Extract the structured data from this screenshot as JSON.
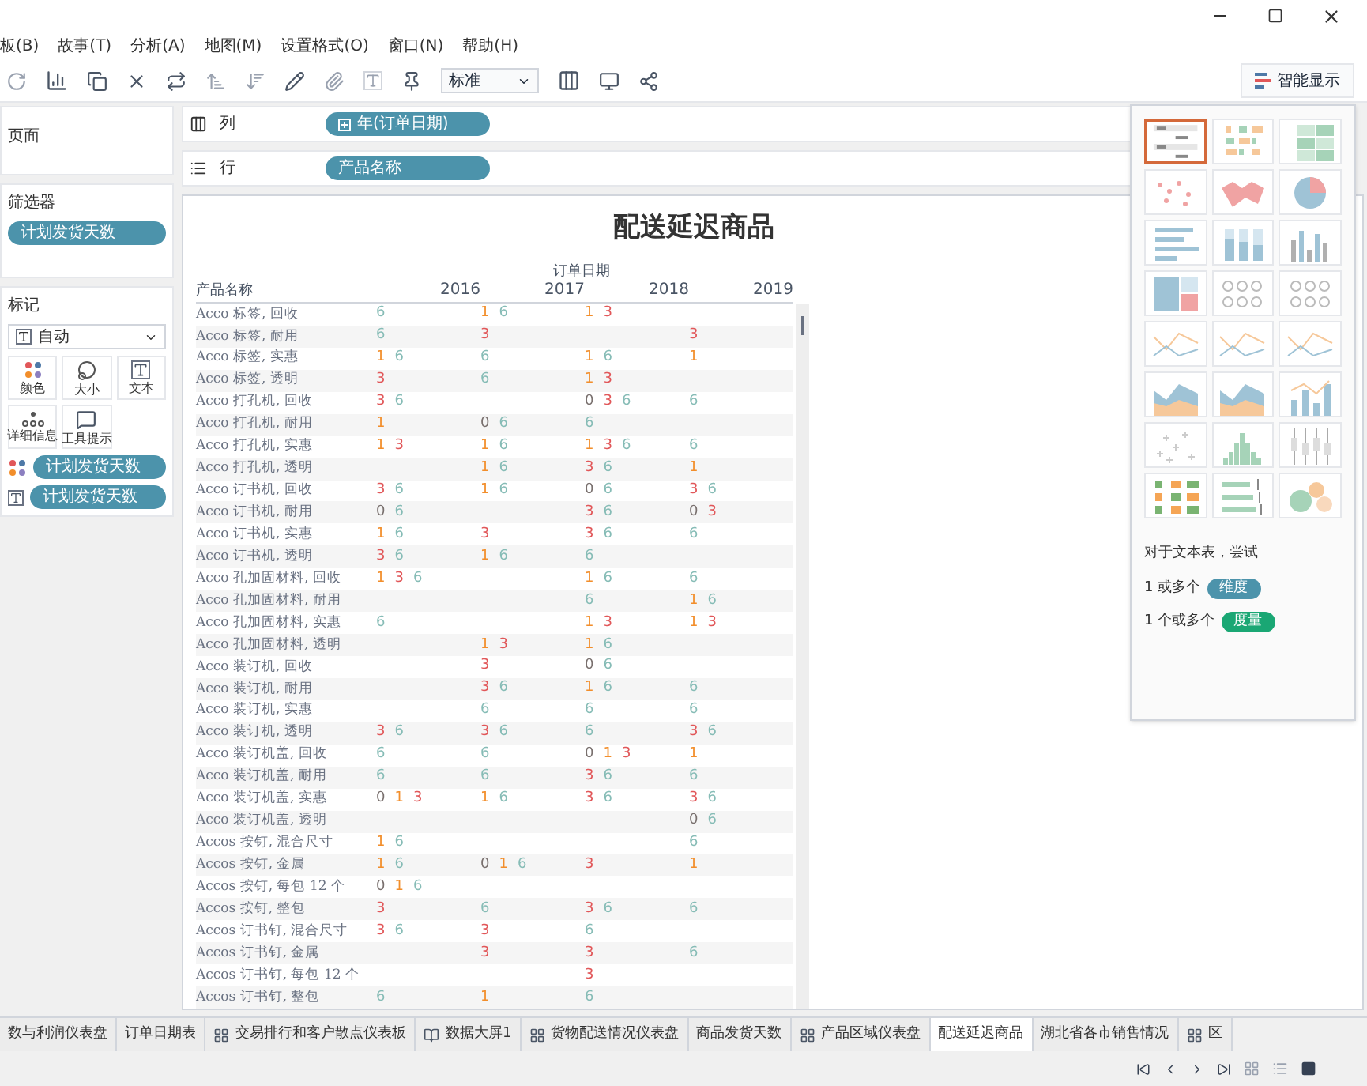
{
  "menu": [
    "板(B)",
    "故事(T)",
    "分析(A)",
    "地图(M)",
    "设置格式(O)",
    "窗口(N)",
    "帮助(H)"
  ],
  "toolbar": {
    "fit_select": "标准",
    "show_me_button": "智能显示"
  },
  "pages_card": {
    "title": "页面"
  },
  "filters_card": {
    "title": "筛选器",
    "pills": [
      "计划发货天数"
    ]
  },
  "marks_card": {
    "title": "标记",
    "mark_type": "自动",
    "buttons": [
      {
        "kind": "color",
        "label": "颜色"
      },
      {
        "kind": "size",
        "label": "大小"
      },
      {
        "kind": "text",
        "label": "文本"
      },
      {
        "kind": "detail",
        "label": "详细信息"
      },
      {
        "kind": "tooltip",
        "label": "工具提示"
      }
    ],
    "pills": [
      {
        "kind": "color",
        "label": "计划发货天数"
      },
      {
        "kind": "text",
        "label": "计划发货天数"
      }
    ]
  },
  "shelves": [
    {
      "kind": "columns",
      "label": "列",
      "pill": "年(订单日期)",
      "expandable": true
    },
    {
      "kind": "rows",
      "label": "行",
      "pill": "产品名称",
      "expandable": false
    }
  ],
  "viz": {
    "title": "配送延迟商品",
    "column_group": "订单日期",
    "row_header": "产品名称",
    "years": [
      "2016",
      "2017",
      "2018",
      "2019"
    ],
    "rows": [
      {
        "name": "Acco 标签, 回收",
        "cells": [
          [
            {
              "t": "6",
              "color": "#86bcb6"
            }
          ],
          [
            {
              "t": "1",
              "color": "#f28e2b"
            },
            {
              "t": "6",
              "color": "#86bcb6"
            }
          ],
          [
            {
              "t": "1",
              "color": "#f28e2b"
            },
            {
              "t": "3",
              "color": "#e15759"
            }
          ],
          []
        ]
      },
      {
        "name": "Acco 标签, 耐用",
        "cells": [
          [
            {
              "t": "6",
              "color": "#86bcb6"
            }
          ],
          [
            {
              "t": "3",
              "color": "#e15759"
            }
          ],
          [],
          [
            {
              "t": "3",
              "color": "#e15759"
            }
          ]
        ]
      },
      {
        "name": "Acco 标签, 实惠",
        "cells": [
          [
            {
              "t": "1",
              "color": "#f28e2b"
            },
            {
              "t": "6",
              "color": "#86bcb6"
            }
          ],
          [
            {
              "t": "6",
              "color": "#86bcb6"
            }
          ],
          [
            {
              "t": "1",
              "color": "#f28e2b"
            },
            {
              "t": "6",
              "color": "#86bcb6"
            }
          ],
          [
            {
              "t": "1",
              "color": "#f28e2b"
            }
          ]
        ]
      },
      {
        "name": "Acco 标签, 透明",
        "cells": [
          [
            {
              "t": "3",
              "color": "#e15759"
            }
          ],
          [
            {
              "t": "6",
              "color": "#86bcb6"
            }
          ],
          [
            {
              "t": "1",
              "color": "#f28e2b"
            },
            {
              "t": "3",
              "color": "#e15759"
            }
          ],
          []
        ]
      },
      {
        "name": "Acco 打孔机, 回收",
        "cells": [
          [
            {
              "t": "3",
              "color": "#e15759"
            },
            {
              "t": "6",
              "color": "#86bcb6"
            }
          ],
          [],
          [
            {
              "t": "0",
              "color": "#79706e"
            },
            {
              "t": "3",
              "color": "#e15759"
            },
            {
              "t": "6",
              "color": "#86bcb6"
            }
          ],
          [
            {
              "t": "6",
              "color": "#86bcb6"
            }
          ]
        ]
      },
      {
        "name": "Acco 打孔机, 耐用",
        "cells": [
          [
            {
              "t": "1",
              "color": "#f28e2b"
            }
          ],
          [
            {
              "t": "0",
              "color": "#79706e"
            },
            {
              "t": "6",
              "color": "#86bcb6"
            }
          ],
          [
            {
              "t": "6",
              "color": "#86bcb6"
            }
          ],
          []
        ]
      },
      {
        "name": "Acco 打孔机, 实惠",
        "cells": [
          [
            {
              "t": "1",
              "color": "#f28e2b"
            },
            {
              "t": "3",
              "color": "#e15759"
            }
          ],
          [
            {
              "t": "1",
              "color": "#f28e2b"
            },
            {
              "t": "6",
              "color": "#86bcb6"
            }
          ],
          [
            {
              "t": "1",
              "color": "#f28e2b"
            },
            {
              "t": "3",
              "color": "#e15759"
            },
            {
              "t": "6",
              "color": "#86bcb6"
            }
          ],
          [
            {
              "t": "6",
              "color": "#86bcb6"
            }
          ]
        ]
      },
      {
        "name": "Acco 打孔机, 透明",
        "cells": [
          [],
          [
            {
              "t": "1",
              "color": "#f28e2b"
            },
            {
              "t": "6",
              "color": "#86bcb6"
            }
          ],
          [
            {
              "t": "3",
              "color": "#e15759"
            },
            {
              "t": "6",
              "color": "#86bcb6"
            }
          ],
          [
            {
              "t": "1",
              "color": "#f28e2b"
            }
          ]
        ]
      },
      {
        "name": "Acco 订书机, 回收",
        "cells": [
          [
            {
              "t": "3",
              "color": "#e15759"
            },
            {
              "t": "6",
              "color": "#86bcb6"
            }
          ],
          [
            {
              "t": "1",
              "color": "#f28e2b"
            },
            {
              "t": "6",
              "color": "#86bcb6"
            }
          ],
          [
            {
              "t": "0",
              "color": "#79706e"
            },
            {
              "t": "6",
              "color": "#86bcb6"
            }
          ],
          [
            {
              "t": "3",
              "color": "#e15759"
            },
            {
              "t": "6",
              "color": "#86bcb6"
            }
          ]
        ]
      },
      {
        "name": "Acco 订书机, 耐用",
        "cells": [
          [
            {
              "t": "0",
              "color": "#79706e"
            },
            {
              "t": "6",
              "color": "#86bcb6"
            }
          ],
          [],
          [
            {
              "t": "3",
              "color": "#e15759"
            },
            {
              "t": "6",
              "color": "#86bcb6"
            }
          ],
          [
            {
              "t": "0",
              "color": "#79706e"
            },
            {
              "t": "3",
              "color": "#e15759"
            }
          ]
        ]
      },
      {
        "name": "Acco 订书机, 实惠",
        "cells": [
          [
            {
              "t": "1",
              "color": "#f28e2b"
            },
            {
              "t": "6",
              "color": "#86bcb6"
            }
          ],
          [
            {
              "t": "3",
              "color": "#e15759"
            }
          ],
          [
            {
              "t": "3",
              "color": "#e15759"
            },
            {
              "t": "6",
              "color": "#86bcb6"
            }
          ],
          [
            {
              "t": "6",
              "color": "#86bcb6"
            }
          ]
        ]
      },
      {
        "name": "Acco 订书机, 透明",
        "cells": [
          [
            {
              "t": "3",
              "color": "#e15759"
            },
            {
              "t": "6",
              "color": "#86bcb6"
            }
          ],
          [
            {
              "t": "1",
              "color": "#f28e2b"
            },
            {
              "t": "6",
              "color": "#86bcb6"
            }
          ],
          [
            {
              "t": "6",
              "color": "#86bcb6"
            }
          ],
          []
        ]
      },
      {
        "name": "Acco 孔加固材料, 回收",
        "cells": [
          [
            {
              "t": "1",
              "color": "#f28e2b"
            },
            {
              "t": "3",
              "color": "#e15759"
            },
            {
              "t": "6",
              "color": "#86bcb6"
            }
          ],
          [],
          [
            {
              "t": "1",
              "color": "#f28e2b"
            },
            {
              "t": "6",
              "color": "#86bcb6"
            }
          ],
          [
            {
              "t": "6",
              "color": "#86bcb6"
            }
          ]
        ]
      },
      {
        "name": "Acco 孔加固材料, 耐用",
        "cells": [
          [],
          [],
          [
            {
              "t": "6",
              "color": "#86bcb6"
            }
          ],
          [
            {
              "t": "1",
              "color": "#f28e2b"
            },
            {
              "t": "6",
              "color": "#86bcb6"
            }
          ]
        ]
      },
      {
        "name": "Acco 孔加固材料, 实惠",
        "cells": [
          [
            {
              "t": "6",
              "color": "#86bcb6"
            }
          ],
          [],
          [
            {
              "t": "1",
              "color": "#f28e2b"
            },
            {
              "t": "3",
              "color": "#e15759"
            }
          ],
          [
            {
              "t": "1",
              "color": "#f28e2b"
            },
            {
              "t": "3",
              "color": "#e15759"
            }
          ]
        ]
      },
      {
        "name": "Acco 孔加固材料, 透明",
        "cells": [
          [],
          [
            {
              "t": "1",
              "color": "#f28e2b"
            },
            {
              "t": "3",
              "color": "#e15759"
            }
          ],
          [
            {
              "t": "1",
              "color": "#f28e2b"
            },
            {
              "t": "6",
              "color": "#86bcb6"
            }
          ],
          []
        ]
      },
      {
        "name": "Acco 装订机, 回收",
        "cells": [
          [],
          [
            {
              "t": "3",
              "color": "#e15759"
            }
          ],
          [
            {
              "t": "0",
              "color": "#79706e"
            },
            {
              "t": "6",
              "color": "#86bcb6"
            }
          ],
          []
        ]
      },
      {
        "name": "Acco 装订机, 耐用",
        "cells": [
          [],
          [
            {
              "t": "3",
              "color": "#e15759"
            },
            {
              "t": "6",
              "color": "#86bcb6"
            }
          ],
          [
            {
              "t": "1",
              "color": "#f28e2b"
            },
            {
              "t": "6",
              "color": "#86bcb6"
            }
          ],
          [
            {
              "t": "6",
              "color": "#86bcb6"
            }
          ]
        ]
      },
      {
        "name": "Acco 装订机, 实惠",
        "cells": [
          [],
          [
            {
              "t": "6",
              "color": "#86bcb6"
            }
          ],
          [
            {
              "t": "6",
              "color": "#86bcb6"
            }
          ],
          [
            {
              "t": "6",
              "color": "#86bcb6"
            }
          ]
        ]
      },
      {
        "name": "Acco 装订机, 透明",
        "cells": [
          [
            {
              "t": "3",
              "color": "#e15759"
            },
            {
              "t": "6",
              "color": "#86bcb6"
            }
          ],
          [
            {
              "t": "3",
              "color": "#e15759"
            },
            {
              "t": "6",
              "color": "#86bcb6"
            }
          ],
          [
            {
              "t": "6",
              "color": "#86bcb6"
            }
          ],
          [
            {
              "t": "3",
              "color": "#e15759"
            },
            {
              "t": "6",
              "color": "#86bcb6"
            }
          ]
        ]
      },
      {
        "name": "Acco 装订机盖, 回收",
        "cells": [
          [
            {
              "t": "6",
              "color": "#86bcb6"
            }
          ],
          [
            {
              "t": "6",
              "color": "#86bcb6"
            }
          ],
          [
            {
              "t": "0",
              "color": "#79706e"
            },
            {
              "t": "1",
              "color": "#f28e2b"
            },
            {
              "t": "3",
              "color": "#e15759"
            }
          ],
          [
            {
              "t": "1",
              "color": "#f28e2b"
            }
          ]
        ]
      },
      {
        "name": "Acco 装订机盖, 耐用",
        "cells": [
          [
            {
              "t": "6",
              "color": "#86bcb6"
            }
          ],
          [
            {
              "t": "6",
              "color": "#86bcb6"
            }
          ],
          [
            {
              "t": "3",
              "color": "#e15759"
            },
            {
              "t": "6",
              "color": "#86bcb6"
            }
          ],
          [
            {
              "t": "6",
              "color": "#86bcb6"
            }
          ]
        ]
      },
      {
        "name": "Acco 装订机盖, 实惠",
        "cells": [
          [
            {
              "t": "0",
              "color": "#79706e"
            },
            {
              "t": "1",
              "color": "#f28e2b"
            },
            {
              "t": "3",
              "color": "#e15759"
            }
          ],
          [
            {
              "t": "1",
              "color": "#f28e2b"
            },
            {
              "t": "6",
              "color": "#86bcb6"
            }
          ],
          [
            {
              "t": "3",
              "color": "#e15759"
            },
            {
              "t": "6",
              "color": "#86bcb6"
            }
          ],
          [
            {
              "t": "3",
              "color": "#e15759"
            },
            {
              "t": "6",
              "color": "#86bcb6"
            }
          ]
        ]
      },
      {
        "name": "Acco 装订机盖, 透明",
        "cells": [
          [],
          [],
          [],
          [
            {
              "t": "0",
              "color": "#79706e"
            },
            {
              "t": "6",
              "color": "#86bcb6"
            }
          ]
        ]
      },
      {
        "name": "Accos 按钉, 混合尺寸",
        "cells": [
          [
            {
              "t": "1",
              "color": "#f28e2b"
            },
            {
              "t": "6",
              "color": "#86bcb6"
            }
          ],
          [],
          [],
          [
            {
              "t": "6",
              "color": "#86bcb6"
            }
          ]
        ]
      },
      {
        "name": "Accos 按钉, 金属",
        "cells": [
          [
            {
              "t": "1",
              "color": "#f28e2b"
            },
            {
              "t": "6",
              "color": "#86bcb6"
            }
          ],
          [
            {
              "t": "0",
              "color": "#79706e"
            },
            {
              "t": "1",
              "color": "#f28e2b"
            },
            {
              "t": "6",
              "color": "#86bcb6"
            }
          ],
          [
            {
              "t": "3",
              "color": "#e15759"
            }
          ],
          [
            {
              "t": "1",
              "color": "#f28e2b"
            }
          ]
        ]
      },
      {
        "name": "Accos 按钉, 每包 12 个",
        "cells": [
          [
            {
              "t": "0",
              "color": "#79706e"
            },
            {
              "t": "1",
              "color": "#f28e2b"
            },
            {
              "t": "6",
              "color": "#86bcb6"
            }
          ],
          [],
          [],
          []
        ]
      },
      {
        "name": "Accos 按钉, 整包",
        "cells": [
          [
            {
              "t": "3",
              "color": "#e15759"
            }
          ],
          [
            {
              "t": "6",
              "color": "#86bcb6"
            }
          ],
          [
            {
              "t": "3",
              "color": "#e15759"
            },
            {
              "t": "6",
              "color": "#86bcb6"
            }
          ],
          [
            {
              "t": "6",
              "color": "#86bcb6"
            }
          ]
        ]
      },
      {
        "name": "Accos 订书钉, 混合尺寸",
        "cells": [
          [
            {
              "t": "3",
              "color": "#e15759"
            },
            {
              "t": "6",
              "color": "#86bcb6"
            }
          ],
          [
            {
              "t": "3",
              "color": "#e15759"
            }
          ],
          [
            {
              "t": "6",
              "color": "#86bcb6"
            }
          ],
          []
        ]
      },
      {
        "name": "Accos 订书钉, 金属",
        "cells": [
          [],
          [
            {
              "t": "3",
              "color": "#e15759"
            }
          ],
          [
            {
              "t": "3",
              "color": "#e15759"
            }
          ],
          [
            {
              "t": "6",
              "color": "#86bcb6"
            }
          ]
        ]
      },
      {
        "name": "Accos 订书钉, 每包 12 个",
        "cells": [
          [],
          [],
          [
            {
              "t": "3",
              "color": "#e15759"
            }
          ],
          []
        ]
      },
      {
        "name": "Accos 订书钉, 整包",
        "cells": [
          [
            {
              "t": "6",
              "color": "#86bcb6"
            }
          ],
          [
            {
              "t": "1",
              "color": "#f28e2b"
            }
          ],
          [
            {
              "t": "6",
              "color": "#86bcb6"
            }
          ],
          []
        ]
      }
    ]
  },
  "show_me": {
    "charts": [
      {
        "kind": "table",
        "selected": true
      },
      {
        "kind": "heatmap",
        "selected": false
      },
      {
        "kind": "highlight",
        "selected": false
      },
      {
        "kind": "dotmap",
        "selected": false
      },
      {
        "kind": "map",
        "selected": false
      },
      {
        "kind": "pie",
        "selected": false
      },
      {
        "kind": "hbar",
        "selected": false
      },
      {
        "kind": "stacked",
        "selected": false
      },
      {
        "kind": "vbar",
        "selected": false
      },
      {
        "kind": "treemap",
        "selected": false
      },
      {
        "kind": "circles",
        "selected": false
      },
      {
        "kind": "circles",
        "selected": false
      },
      {
        "kind": "line",
        "selected": false
      },
      {
        "kind": "line",
        "selected": false
      },
      {
        "kind": "line",
        "selected": false
      },
      {
        "kind": "area",
        "selected": false
      },
      {
        "kind": "area",
        "selected": false
      },
      {
        "kind": "combo",
        "selected": false
      },
      {
        "kind": "scatter",
        "selected": false
      },
      {
        "kind": "histogram",
        "selected": false
      },
      {
        "kind": "box",
        "selected": false
      },
      {
        "kind": "gantt",
        "selected": false
      },
      {
        "kind": "bullet",
        "selected": false
      },
      {
        "kind": "bubbles",
        "selected": false
      }
    ],
    "hint": "对于文本表，尝试",
    "requirements": [
      {
        "kind": "dimension",
        "prefix": "1 或多个",
        "pill": "维度"
      },
      {
        "kind": "measure",
        "prefix": "1 个或多个",
        "pill": "度量"
      }
    ]
  },
  "sheet_tabs": [
    {
      "kind": "sheet",
      "label": "数与利润仪表盘",
      "selected": false
    },
    {
      "kind": "sheet",
      "label": "订单日期表",
      "selected": false
    },
    {
      "kind": "dashboard",
      "label": "交易排行和客户散点仪表板",
      "selected": false
    },
    {
      "kind": "story",
      "label": "数据大屏1",
      "selected": false
    },
    {
      "kind": "dashboard",
      "label": "货物配送情况仪表盘",
      "selected": false
    },
    {
      "kind": "sheet",
      "label": "商品发货天数",
      "selected": false
    },
    {
      "kind": "dashboard",
      "label": "产品区域仪表盘",
      "selected": false
    },
    {
      "kind": "sheet",
      "label": "配送延迟商品",
      "selected": true
    },
    {
      "kind": "sheet",
      "label": "湖北省各市销售情况",
      "selected": false
    },
    {
      "kind": "dashboard",
      "label": "区",
      "selected": false
    }
  ]
}
